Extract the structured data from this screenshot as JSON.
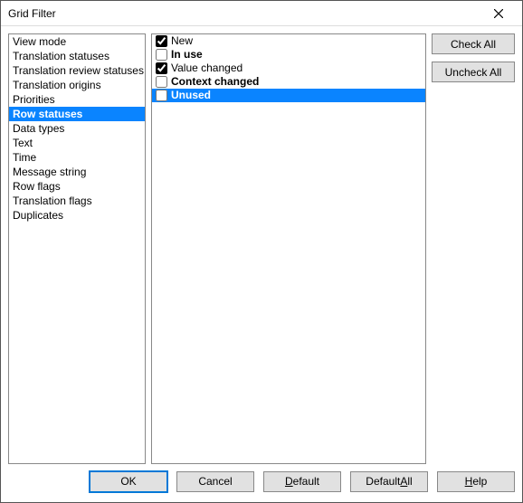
{
  "title": "Grid Filter",
  "categories": [
    {
      "label": "View mode",
      "selected": false
    },
    {
      "label": "Translation statuses",
      "selected": false
    },
    {
      "label": "Translation review statuses",
      "selected": false
    },
    {
      "label": "Translation origins",
      "selected": false
    },
    {
      "label": "Priorities",
      "selected": false
    },
    {
      "label": "Row statuses",
      "selected": true
    },
    {
      "label": "Data types",
      "selected": false
    },
    {
      "label": "Text",
      "selected": false
    },
    {
      "label": "Time",
      "selected": false
    },
    {
      "label": "Message string",
      "selected": false
    },
    {
      "label": "Row flags",
      "selected": false
    },
    {
      "label": "Translation flags",
      "selected": false
    },
    {
      "label": "Duplicates",
      "selected": false
    }
  ],
  "options": [
    {
      "label": "New",
      "checked": true,
      "bold": false,
      "selected": false
    },
    {
      "label": "In use",
      "checked": false,
      "bold": true,
      "selected": false
    },
    {
      "label": "Value changed",
      "checked": true,
      "bold": false,
      "selected": false
    },
    {
      "label": "Context changed",
      "checked": false,
      "bold": true,
      "selected": false
    },
    {
      "label": "Unused",
      "checked": false,
      "bold": true,
      "selected": true
    }
  ],
  "side": {
    "check_all": "Check All",
    "uncheck_all": "Uncheck All"
  },
  "buttons": {
    "ok": "OK",
    "cancel": "Cancel",
    "default": "Default",
    "default_all_pre": "Default ",
    "default_all_mn": "A",
    "default_all_post": "ll",
    "help_mn": "H",
    "help_post": "elp",
    "default_mn": "D",
    "default_post": "efault"
  }
}
